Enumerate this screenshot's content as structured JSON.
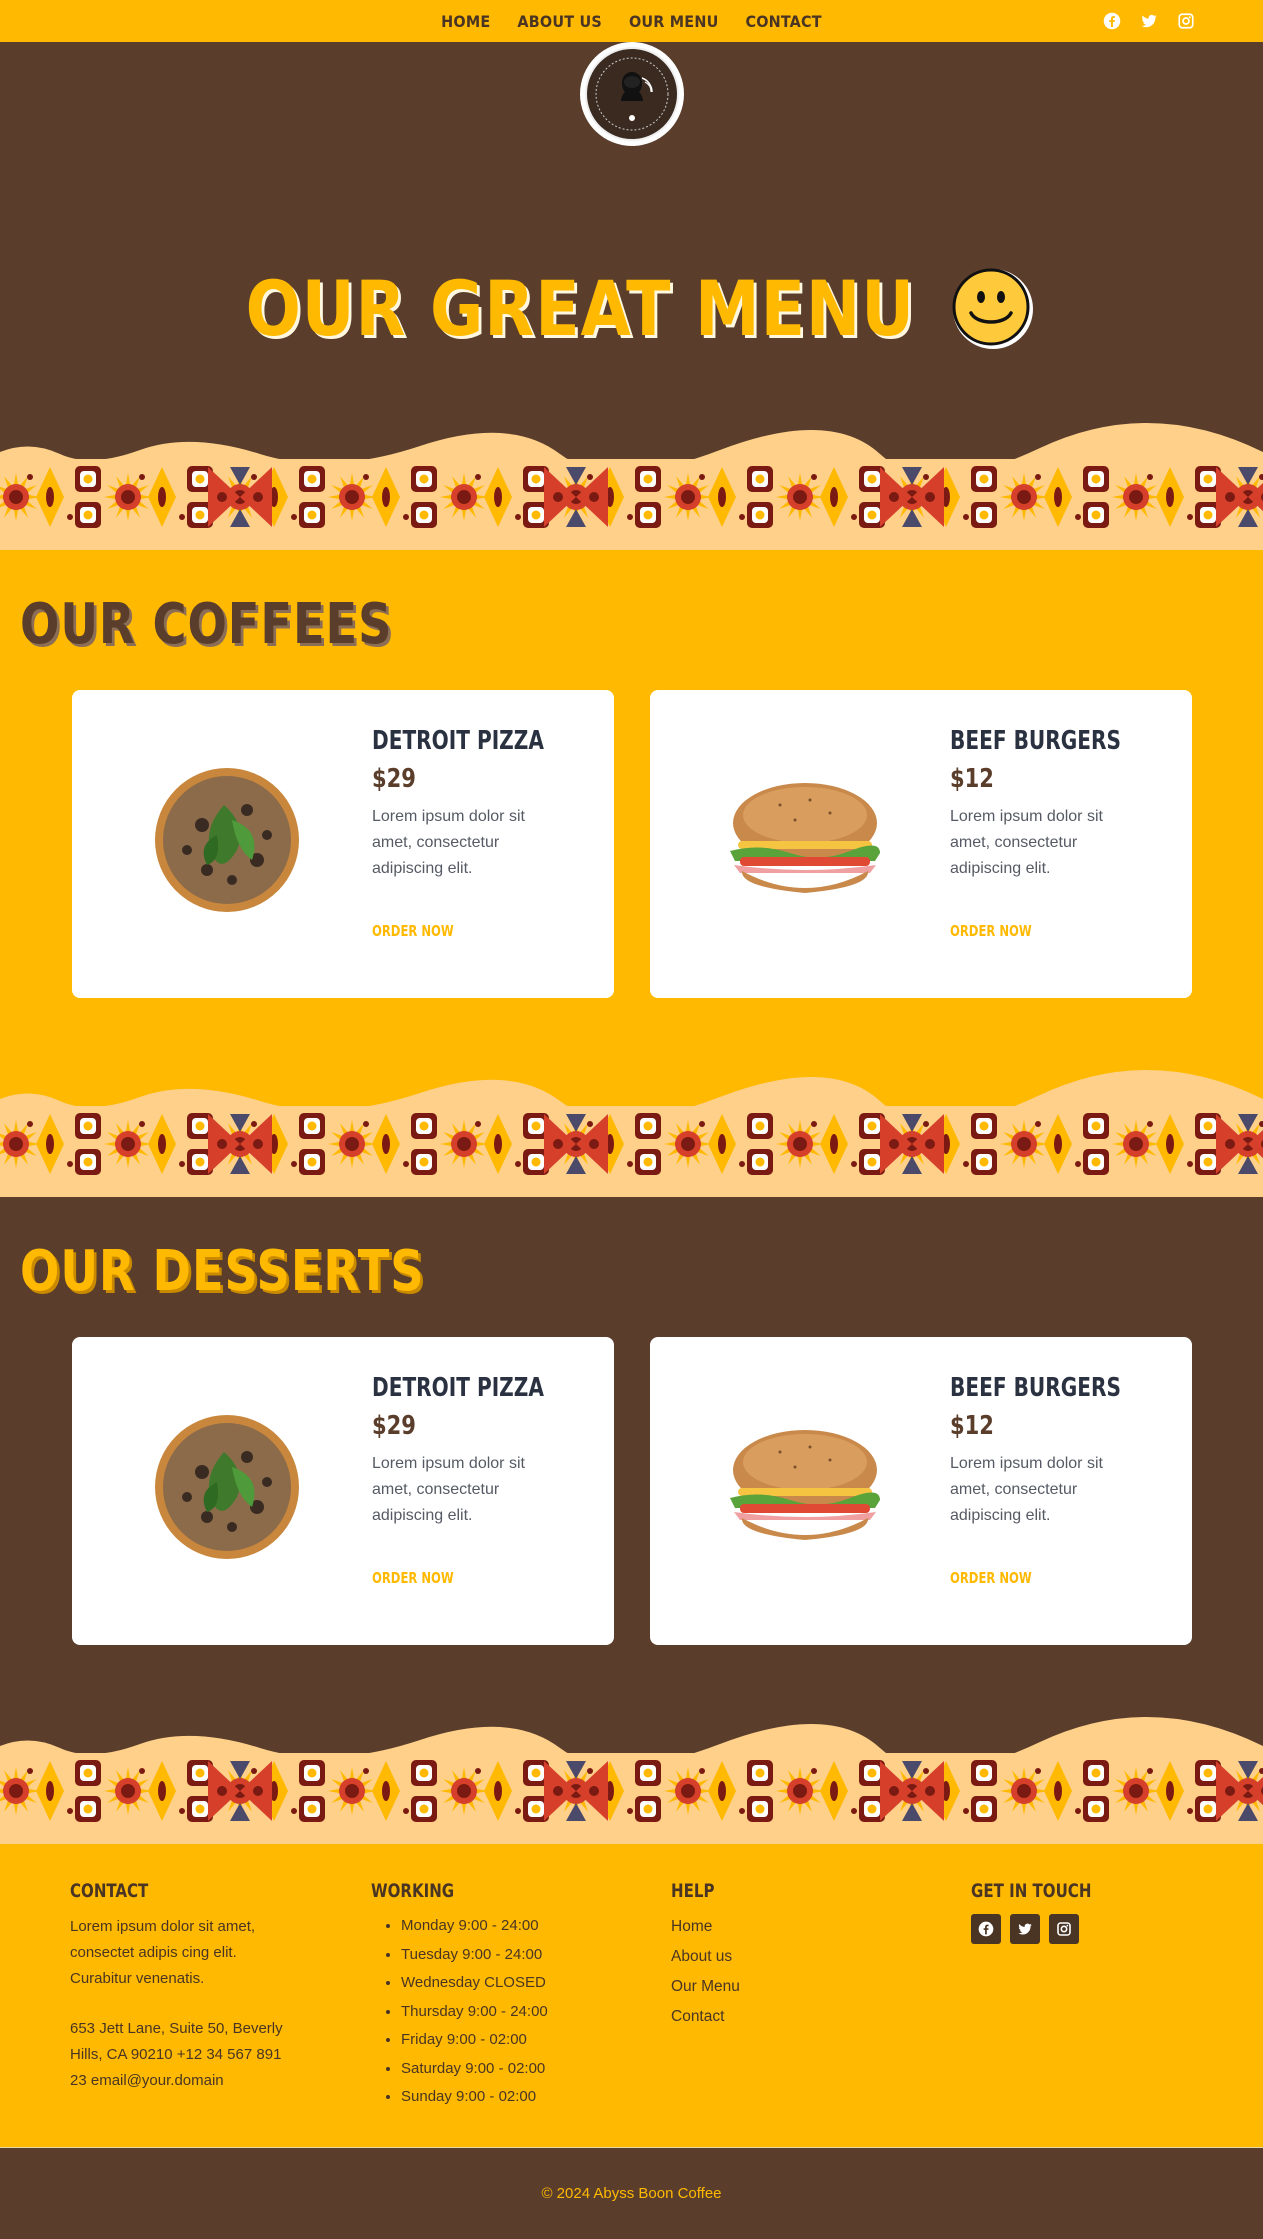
{
  "nav": {
    "links": [
      "HOME",
      "ABOUT US",
      "OUR MENU",
      "CONTACT"
    ],
    "social": [
      {
        "icon": "facebook-icon"
      },
      {
        "icon": "twitter-icon"
      },
      {
        "icon": "instagram-icon"
      }
    ]
  },
  "hero": {
    "title": "OUR GREAT MENU",
    "emoji": "smiley-icon"
  },
  "coffees": {
    "heading": "OUR COFFEES",
    "items": [
      {
        "title": "DETROIT PIZZA",
        "price": "$29",
        "description": "Lorem ipsum dolor sit amet, consectetur adipiscing elit.",
        "cta": "ORDER NOW",
        "image": "pizza"
      },
      {
        "title": "BEEF BURGERS",
        "price": "$12",
        "description": "Lorem ipsum dolor sit amet, consectetur adipiscing elit.",
        "cta": "ORDER NOW",
        "image": "burger"
      }
    ]
  },
  "desserts": {
    "heading": "OUR DESSERTS",
    "items": [
      {
        "title": "DETROIT PIZZA",
        "price": "$29",
        "description": "Lorem ipsum dolor sit amet, consectetur adipiscing elit.",
        "cta": "ORDER NOW",
        "image": "pizza"
      },
      {
        "title": "BEEF BURGERS",
        "price": "$12",
        "description": "Lorem ipsum dolor sit amet, consectetur adipiscing elit.",
        "cta": "ORDER NOW",
        "image": "burger"
      }
    ]
  },
  "footer": {
    "contact": {
      "heading": "CONTACT",
      "text": "Lorem ipsum dolor sit amet, consectet adipis cing elit. Curabitur venenatis.",
      "address": "653 Jett Lane, Suite 50, Beverly Hills, CA 90210 +12 34 567 891 23 email@your.domain"
    },
    "working": {
      "heading": "WORKING",
      "hours": [
        "Monday 9:00 - 24:00",
        "Tuesday 9:00 - 24:00",
        "Wednesday CLOSED",
        "Thursday 9:00 - 24:00",
        "Friday 9:00 - 02:00",
        "Saturday 9:00 - 02:00",
        "Sunday 9:00 - 02:00"
      ]
    },
    "help": {
      "heading": "HELP",
      "links": [
        "Home",
        "About us",
        "Our Menu",
        "Contact"
      ]
    },
    "getintouch": {
      "heading": "GET IN TOUCH",
      "social": [
        "facebook-icon",
        "twitter-icon",
        "instagram-icon"
      ]
    },
    "copyright": "© 2024 Abyss Boon Coffee"
  },
  "colors": {
    "brand_yellow": "#ffb900",
    "brand_brown": "#5a3e2b",
    "pattern_cream": "#ffd08a",
    "pattern_red": "#d6402b",
    "pattern_maroon": "#7a1a12"
  }
}
